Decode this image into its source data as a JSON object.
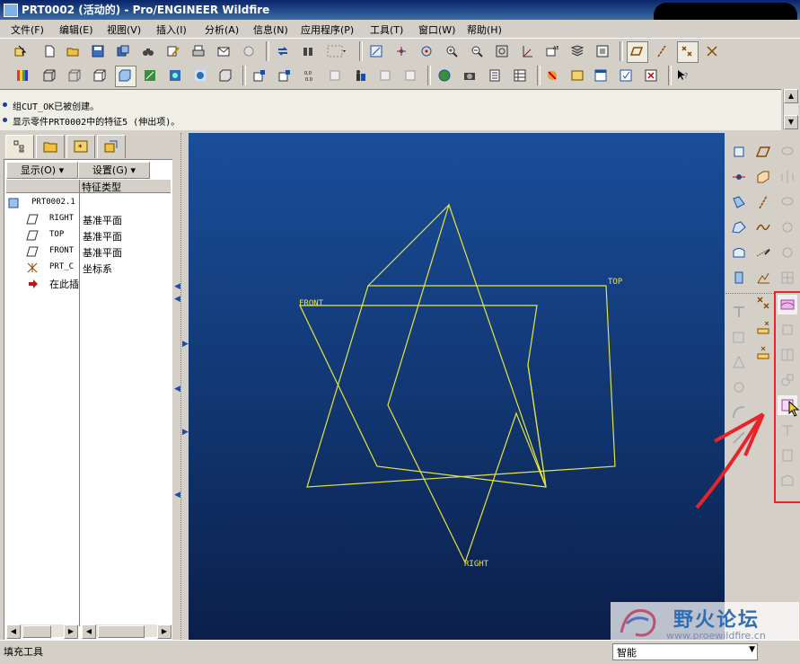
{
  "window": {
    "title": "PRT0002 (活动的) - Pro/ENGINEER Wildfire"
  },
  "menu": [
    "文件(F)",
    "编辑(E)",
    "视图(V)",
    "插入(I)",
    "分析(A)",
    "信息(N)",
    "应用程序(P)",
    "工具(T)",
    "窗口(W)",
    "帮助(H)"
  ],
  "messages": [
    "组CUT_OK已被创建。",
    "显示零件PRT0002中的特征5 (伸出项)。"
  ],
  "navigator": {
    "show_label": "显示(O)",
    "settings_label": "设置(G)",
    "column_header": "特征类型",
    "root_name": "PRT0002.1",
    "rows": [
      {
        "name": "RIGHT",
        "type": "基准平面",
        "icon": "datum-plane-icon"
      },
      {
        "name": "TOP",
        "type": "基准平面",
        "icon": "datum-plane-icon"
      },
      {
        "name": "FRONT",
        "type": "基准平面",
        "icon": "datum-plane-icon"
      },
      {
        "name": "PRT_C",
        "type": "坐标系",
        "icon": "coordinate-system-icon"
      },
      {
        "name": "在此插",
        "type": "",
        "icon": "insert-here-arrow-icon"
      }
    ]
  },
  "graphics": {
    "labels": {
      "front": "FRONT",
      "top": "TOP",
      "right": "RIGHT"
    },
    "line_color": "#e6e63a"
  },
  "status": {
    "left_text": "填充工具",
    "filter_value": "智能"
  },
  "watermark": {
    "brand": "野火论坛",
    "url": "www.proewildfire.cn"
  },
  "colors": {
    "accent_red": "#e8242a",
    "datum_yellow": "#e6e63a"
  }
}
